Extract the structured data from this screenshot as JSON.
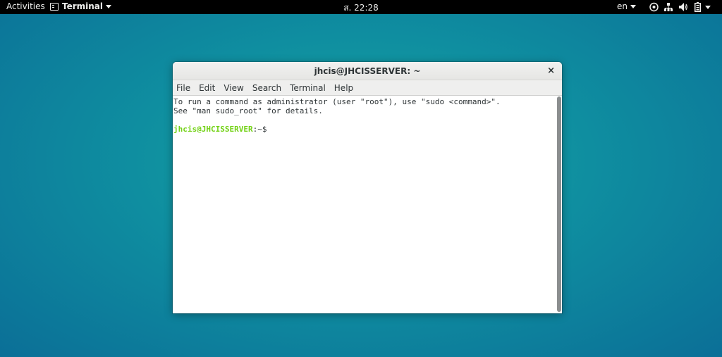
{
  "topbar": {
    "activities": "Activities",
    "app_name": "Terminal",
    "clock": "ส. 22:28",
    "language": "en",
    "tray_icons": [
      "accessibility-icon",
      "network-wired-icon",
      "volume-icon",
      "battery-icon"
    ]
  },
  "window": {
    "title": "jhcis@JHCISSERVER: ~",
    "close_label": "×",
    "menu": [
      "File",
      "Edit",
      "View",
      "Search",
      "Terminal",
      "Help"
    ]
  },
  "terminal": {
    "line1": "To run a command as administrator (user \"root\"), use \"sudo <command>\".",
    "line2": "See \"man sudo_root\" for details.",
    "prompt_user": "jhcis@JHCISSERVER",
    "prompt_path": ":~$"
  },
  "colors": {
    "prompt": "#73d216",
    "text": "#2e3436",
    "desktop": "#0f8ea0"
  }
}
